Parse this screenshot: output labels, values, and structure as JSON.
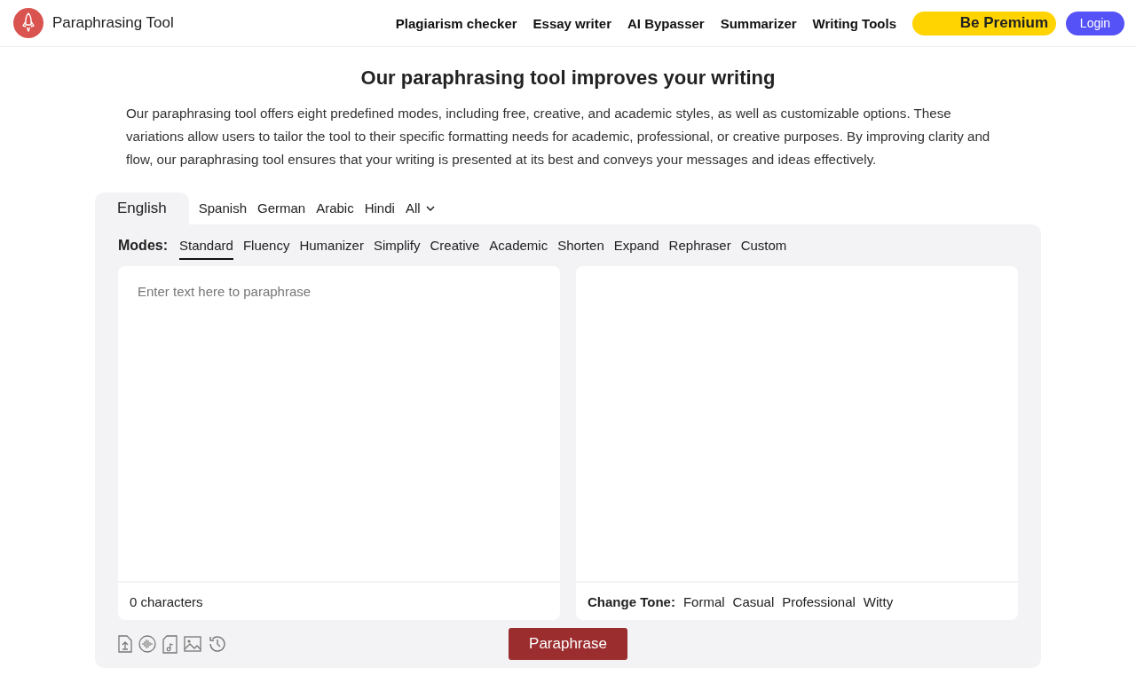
{
  "header": {
    "brand": "Paraphrasing Tool",
    "nav": [
      "Plagiarism checker",
      "Essay writer",
      "AI Bypasser",
      "Summarizer",
      "Writing Tools"
    ],
    "premium": "Be Premium",
    "login": "Login"
  },
  "heading": "Our paraphrasing tool improves your writing",
  "intro": "Our paraphrasing tool offers eight predefined modes, including free, creative, and academic styles, as well as customizable options. These variations allow users to tailor the tool to their specific formatting needs for academic, professional, or creative purposes. By improving clarity and flow, our paraphrasing tool ensures that your writing is presented at its best and conveys your messages and ideas effectively.",
  "languages": [
    {
      "label": "English",
      "selected": true
    },
    {
      "label": "Spanish",
      "selected": false
    },
    {
      "label": "German",
      "selected": false
    },
    {
      "label": "Arabic",
      "selected": false
    },
    {
      "label": "Hindi",
      "selected": false
    },
    {
      "label": "All",
      "selected": false,
      "kind": "dropdown"
    }
  ],
  "modes": {
    "label": "Modes:",
    "items": [
      {
        "label": "Standard",
        "selected": true
      },
      {
        "label": "Fluency",
        "selected": false
      },
      {
        "label": "Humanizer",
        "selected": false
      },
      {
        "label": "Simplify",
        "selected": false
      },
      {
        "label": "Creative",
        "selected": false
      },
      {
        "label": "Academic",
        "selected": false
      },
      {
        "label": "Shorten",
        "selected": false
      },
      {
        "label": "Expand",
        "selected": false
      },
      {
        "label": "Rephraser",
        "selected": false
      },
      {
        "label": "Custom",
        "selected": false
      }
    ]
  },
  "input": {
    "placeholder": "Enter text here to paraphrase",
    "count": "0 characters"
  },
  "output": {
    "tone_label": "Change Tone:",
    "tones": [
      "Formal",
      "Casual",
      "Professional",
      "Witty"
    ]
  },
  "tools": [
    {
      "kind": "upload"
    },
    {
      "kind": "audio"
    },
    {
      "kind": "music"
    },
    {
      "kind": "image"
    },
    {
      "kind": "history"
    }
  ],
  "action": "Paraphrase"
}
